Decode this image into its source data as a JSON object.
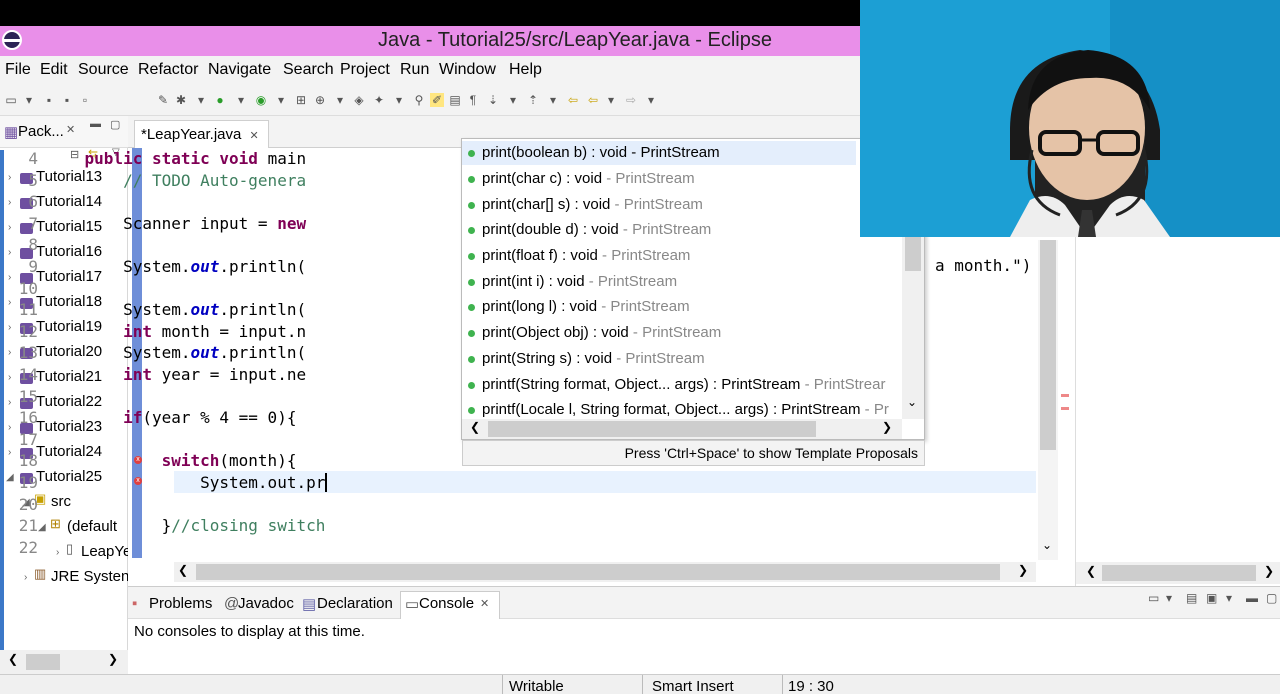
{
  "window": {
    "title": "Java - Tutorial25/src/LeapYear.java - Eclipse"
  },
  "menu": [
    "File",
    "Edit",
    "Source",
    "Refactor",
    "Navigate",
    "Search",
    "Project",
    "Run",
    "Window",
    "Help"
  ],
  "package_explorer": {
    "tab_label": "Pack...",
    "projects": [
      "Tutorial13",
      "Tutorial14",
      "Tutorial15",
      "Tutorial16",
      "Tutorial17",
      "Tutorial18",
      "Tutorial19",
      "Tutorial20",
      "Tutorial21",
      "Tutorial22",
      "Tutorial23",
      "Tutorial24",
      "Tutorial25"
    ],
    "src": "src",
    "default_pkg": "(default",
    "file": "LeapYe",
    "jre": "JRE Systen"
  },
  "editor": {
    "tab_label": "*LeapYear.java",
    "line_numbers": [
      "4",
      "5",
      "6",
      "7",
      "8",
      "9",
      "10",
      "11",
      "12",
      "13",
      "14",
      "15",
      "16",
      "17",
      "18",
      "19",
      "20",
      "21",
      "22"
    ],
    "right_snippet": "a month.\")"
  },
  "autocomplete": {
    "items": [
      {
        "main": "print(boolean b) : void",
        "sep": " - ",
        "src": "PrintStream"
      },
      {
        "main": "print(char c) : void",
        "sep": " - ",
        "src": "PrintStream"
      },
      {
        "main": "print(char[] s) : void",
        "sep": " - ",
        "src": "PrintStream"
      },
      {
        "main": "print(double d) : void",
        "sep": " - ",
        "src": "PrintStream"
      },
      {
        "main": "print(float f) : void",
        "sep": " - ",
        "src": "PrintStream"
      },
      {
        "main": "print(int i) : void",
        "sep": " - ",
        "src": "PrintStream"
      },
      {
        "main": "print(long l) : void",
        "sep": " - ",
        "src": "PrintStream"
      },
      {
        "main": "print(Object obj) : void",
        "sep": " - ",
        "src": "PrintStream"
      },
      {
        "main": "print(String s) : void",
        "sep": " - ",
        "src": "PrintStream"
      },
      {
        "main": "printf(String format, Object... args) : PrintStream",
        "sep": " - ",
        "src": "PrintStrear"
      },
      {
        "main": "printf(Locale l, String format, Object... args) : PrintStream",
        "sep": " - ",
        "src": "Pr"
      }
    ],
    "footer": "Press 'Ctrl+Space' to show Template Proposals"
  },
  "bottom": {
    "tabs": [
      "Problems",
      "Javadoc",
      "Declaration",
      "Console"
    ],
    "message": "No consoles to display at this time."
  },
  "status": {
    "writable": "Writable",
    "insert_mode": "Smart Insert",
    "position": "19 : 30"
  }
}
